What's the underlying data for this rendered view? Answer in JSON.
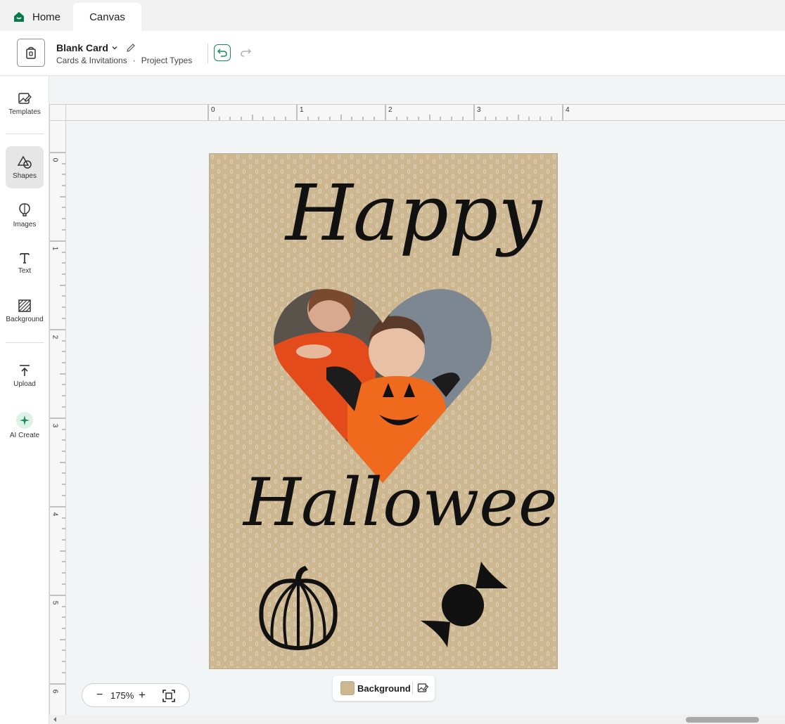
{
  "tabs": {
    "home_label": "Home",
    "canvas_label": "Canvas"
  },
  "header": {
    "project_name": "Blank Card",
    "category": "Cards & Invitations",
    "separator": "·",
    "project_types": "Project Types"
  },
  "sidebar": {
    "items": [
      {
        "label": "Templates",
        "icon": "templates-icon"
      },
      {
        "label": "Shapes",
        "icon": "shapes-icon"
      },
      {
        "label": "Images",
        "icon": "images-icon"
      },
      {
        "label": "Text",
        "icon": "text-icon"
      },
      {
        "label": "Background",
        "icon": "background-icon"
      },
      {
        "label": "Upload",
        "icon": "upload-icon"
      },
      {
        "label": "AI Create",
        "icon": "ai-create-icon"
      }
    ]
  },
  "ruler": {
    "top_labels": [
      "0",
      "1",
      "2",
      "3",
      "4"
    ],
    "left_labels": [
      "0",
      "1",
      "2",
      "3",
      "4",
      "5",
      "6"
    ]
  },
  "card": {
    "line1": "Happy",
    "line2": "Halloween",
    "background_color": "#cdb791"
  },
  "zoom": {
    "minus": "−",
    "value": "175%",
    "plus": "+"
  },
  "background_chip": {
    "label": "Background",
    "swatch_color": "#cdb791"
  },
  "colors": {
    "accent": "#1a8a5c",
    "home_icon": "#0b7a4a"
  }
}
